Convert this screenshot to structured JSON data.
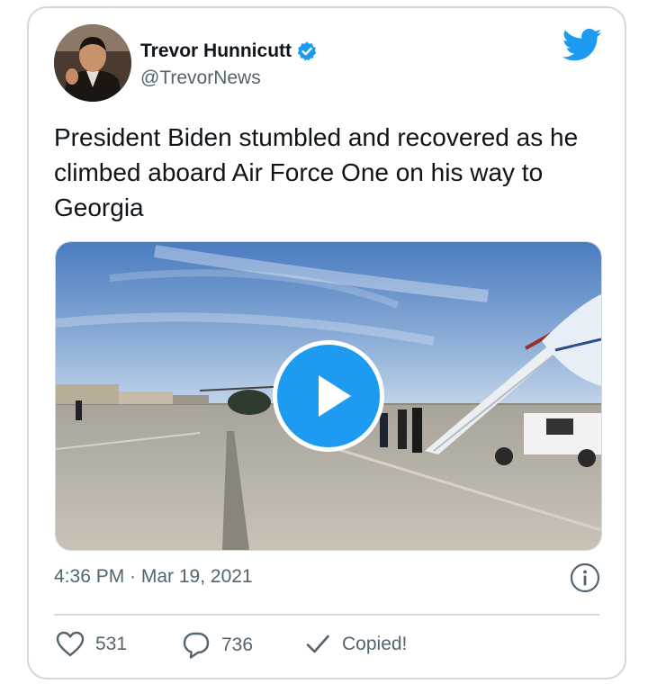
{
  "tweet": {
    "author_name": "Trevor Hunnicutt",
    "author_handle": "@TrevorNews",
    "verified": true,
    "text": "President Biden stumbled and recovered as he climbed aboard Air Force One on his way to Georgia",
    "timestamp": "4:36 PM · Mar 19, 2021"
  },
  "actions": {
    "like_count": "531",
    "reply_count": "736",
    "copy_label": "Copied!"
  },
  "icons": {
    "brand": "twitter-bird-icon",
    "verified": "verified-badge-icon",
    "info": "info-icon",
    "like": "heart-icon",
    "reply": "speech-bubble-icon",
    "copy": "checkmark-icon",
    "play": "play-icon"
  },
  "colors": {
    "brand_blue": "#1d9bf0",
    "text_primary": "#0f1419",
    "text_secondary": "#536471",
    "border": "#cfd9de"
  }
}
